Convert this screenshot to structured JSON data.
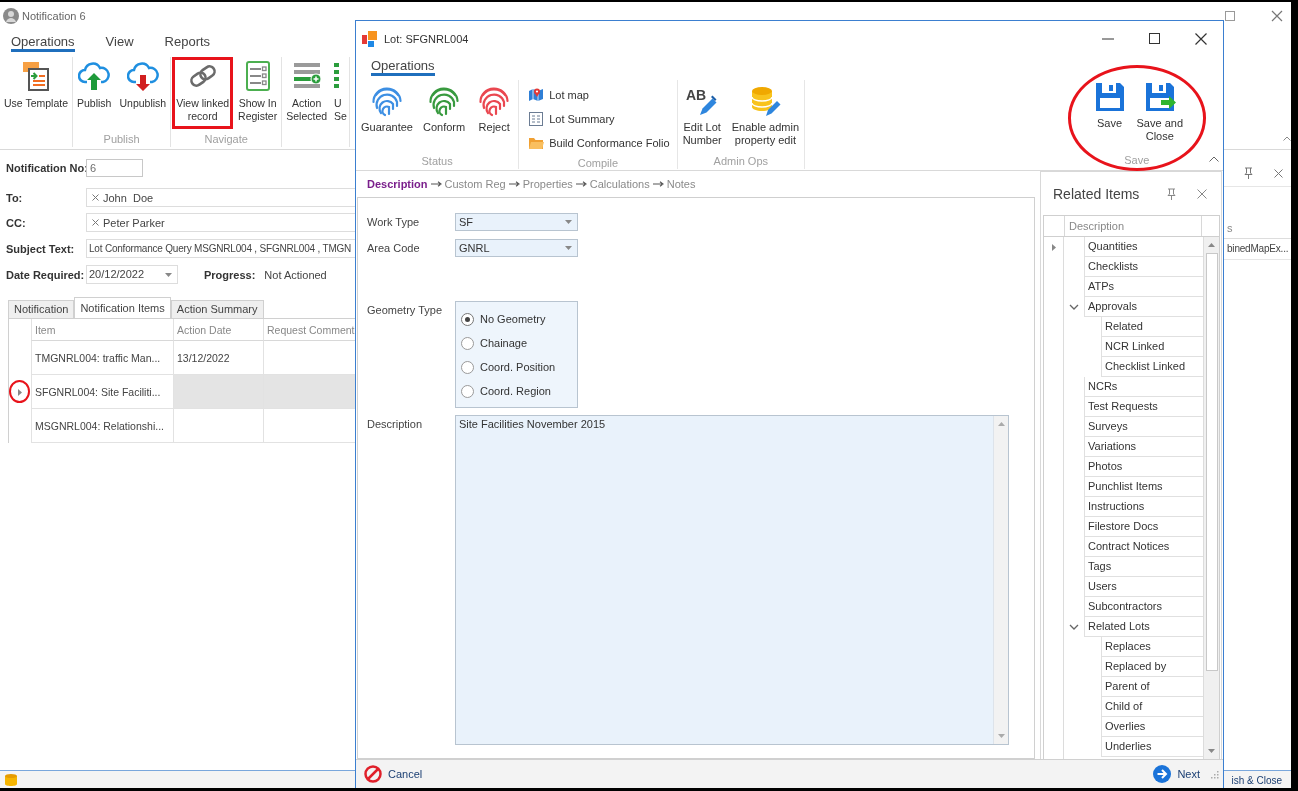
{
  "window": {
    "title": "Notification 6",
    "ribbon": {
      "tabs": [
        {
          "label": "Operations",
          "selected": true
        },
        {
          "label": "View",
          "selected": false
        },
        {
          "label": "Reports",
          "selected": false
        }
      ],
      "groups": [
        {
          "buttons": [
            {
              "label": "Use Template",
              "kind": "template",
              "highlighted": false
            }
          ]
        },
        {
          "label": "Publish",
          "buttons": [
            {
              "label": "Publish",
              "kind": "upload",
              "highlighted": false
            },
            {
              "label": "Unpublish",
              "kind": "download",
              "highlighted": false
            }
          ]
        },
        {
          "label": "Navigate",
          "buttons": [
            {
              "label": "View linked\nrecord",
              "kind": "link",
              "highlighted": true
            },
            {
              "label": "Show In\nRegister",
              "kind": "register",
              "highlighted": false
            }
          ]
        },
        {
          "buttons": [
            {
              "label": "Action\nSelected",
              "kind": "action",
              "highlighted": false
            },
            {
              "label": "U\nSe",
              "kind": "partial",
              "highlighted": false
            }
          ]
        }
      ]
    },
    "form": {
      "notification_no": {
        "label": "Notification No:",
        "value": "6"
      },
      "to": {
        "label": "To:",
        "chips": [
          "John  Doe"
        ]
      },
      "cc": {
        "label": "CC:",
        "chips": [
          "Peter Parker"
        ]
      },
      "subject": {
        "label": "Subject Text:",
        "value": "Lot Conformance Query MSGNRL004 , SFGNRL004 , TMGN"
      },
      "date_required": {
        "label": "Date Required:",
        "value": "20/12/2022"
      },
      "progress": {
        "label": "Progress:",
        "value": "Not Actioned"
      }
    },
    "tabs": [
      {
        "label": "Notification",
        "selected": false
      },
      {
        "label": "Notification Items",
        "selected": true
      },
      {
        "label": "Action Summary",
        "selected": false
      }
    ],
    "table": {
      "columns": [
        "Item",
        "Action Date",
        "Request Comment"
      ],
      "rows": [
        {
          "item": "TMGNRL004: traffic Man...",
          "action_date": "13/12/2022",
          "selected": false,
          "highlighted": false
        },
        {
          "item": "SFGNRL004: Site Faciliti...",
          "selected": true,
          "highlighted": true
        },
        {
          "item": "MSGNRL004: Relationshi...",
          "selected": false,
          "highlighted": false
        }
      ]
    },
    "side_panel": {
      "column_header": "s",
      "cell": "binedMapEx..."
    },
    "status_bar": {
      "button": "ish & Close"
    }
  },
  "dialog": {
    "title": "Lot: SFGNRL004",
    "ribbon": {
      "tabs": [
        {
          "label": "Operations",
          "selected": true
        }
      ],
      "groups": [
        {
          "label": "Status",
          "highlighted": false,
          "buttons": [
            {
              "label": "Guarantee",
              "kind": "fingerprint",
              "color": "#3d8fe3"
            },
            {
              "label": "Conform",
              "kind": "fingerprint",
              "color": "#389a3f"
            },
            {
              "label": "Reject",
              "kind": "fingerprint",
              "color": "#ea4750"
            }
          ]
        },
        {
          "label": "Compile",
          "highlighted": false,
          "buttons": [
            {
              "label": "Lot map",
              "kind": "map"
            },
            {
              "label": "Lot Summary",
              "kind": "summary"
            },
            {
              "label": "Build Conformance Folio",
              "kind": "folder"
            }
          ]
        },
        {
          "label": "Admin Ops",
          "highlighted": false,
          "buttons": [
            {
              "label": "Edit Lot\nNumber",
              "kind": "text-edit",
              "icon_text": "AB"
            },
            {
              "label": "Enable admin\nproperty edit",
              "kind": "database-edit"
            }
          ]
        },
        {
          "label": "Save",
          "highlighted": true,
          "buttons": [
            {
              "label": "Save",
              "kind": "save"
            },
            {
              "label": "Save and\nClose",
              "kind": "save-close"
            }
          ]
        }
      ]
    },
    "steps": [
      {
        "label": "Description",
        "selected": true
      },
      {
        "label": "Custom Reg",
        "selected": false
      },
      {
        "label": "Properties",
        "selected": false
      },
      {
        "label": "Calculations",
        "selected": false
      },
      {
        "label": "Notes",
        "selected": false
      }
    ],
    "form": {
      "work_type": {
        "label": "Work Type",
        "value": "SF"
      },
      "area_code": {
        "label": "Area Code",
        "value": "GNRL"
      },
      "geometry_type": {
        "label": "Geometry Type",
        "options": [
          {
            "label": "No Geometry",
            "selected": true
          },
          {
            "label": "Chainage",
            "selected": false
          },
          {
            "label": "Coord. Position",
            "selected": false
          },
          {
            "label": "Coord. Region",
            "selected": false
          }
        ]
      },
      "description": {
        "label": "Description",
        "value": "Site Facilities November 2015"
      }
    },
    "related_items": {
      "title": "Related Items",
      "column": "Description",
      "rows": [
        {
          "label": "Quantities",
          "selected": true
        },
        {
          "label": "Checklists",
          "selected": false
        },
        {
          "label": "ATPs",
          "selected": false
        },
        {
          "label": "Approvals",
          "selected": false,
          "expanded": true,
          "children": [
            {
              "label": "Related",
              "selected": false
            },
            {
              "label": "NCR Linked",
              "selected": false
            },
            {
              "label": "Checklist Linked",
              "selected": false
            }
          ]
        },
        {
          "label": "NCRs",
          "selected": false
        },
        {
          "label": "Test Requests",
          "selected": false
        },
        {
          "label": "Surveys",
          "selected": false
        },
        {
          "label": "Variations",
          "selected": false
        },
        {
          "label": "Photos",
          "selected": false
        },
        {
          "label": "Punchlist Items",
          "selected": false
        },
        {
          "label": "Instructions",
          "selected": false
        },
        {
          "label": "Filestore Docs",
          "selected": false
        },
        {
          "label": "Contract Notices",
          "selected": false
        },
        {
          "label": "Tags",
          "selected": false
        },
        {
          "label": "Users",
          "selected": false
        },
        {
          "label": "Subcontractors",
          "selected": false
        },
        {
          "label": "Related Lots",
          "selected": false,
          "expanded": true,
          "children": [
            {
              "label": "Replaces",
              "selected": false
            },
            {
              "label": "Replaced by",
              "selected": false
            },
            {
              "label": "Parent of",
              "selected": false
            },
            {
              "label": "Child of",
              "selected": false
            },
            {
              "label": "Overlies",
              "selected": false
            },
            {
              "label": "Underlies",
              "selected": false
            }
          ]
        }
      ]
    },
    "footer": {
      "cancel": "Cancel",
      "next": "Next"
    }
  }
}
